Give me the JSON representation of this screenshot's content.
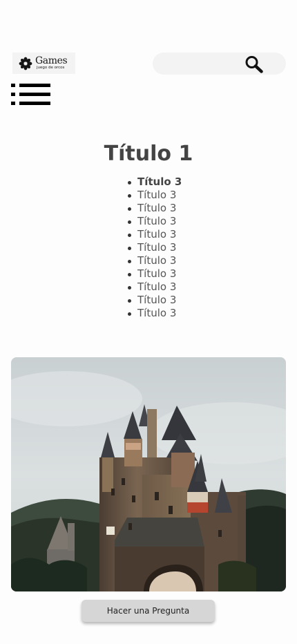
{
  "header": {
    "logo": {
      "brand": "Games",
      "tagline": "juego de orcos"
    },
    "search": {
      "value": "",
      "placeholder": "",
      "icon": "search-icon"
    },
    "menu_icon": "menu-list-icon"
  },
  "main": {
    "title": "Título 1",
    "items": [
      {
        "label": "Título 3",
        "active": true
      },
      {
        "label": "Título 3",
        "active": false
      },
      {
        "label": "Título 3",
        "active": false
      },
      {
        "label": "Título 3",
        "active": false
      },
      {
        "label": "Título 3",
        "active": false
      },
      {
        "label": "Título 3",
        "active": false
      },
      {
        "label": "Título 3",
        "active": false
      },
      {
        "label": "Título 3",
        "active": false
      },
      {
        "label": "Título 3",
        "active": false
      },
      {
        "label": "Título 3",
        "active": false
      },
      {
        "label": "Título 3",
        "active": false
      }
    ],
    "image": {
      "subject": "castle photo"
    }
  },
  "footer": {
    "ask_button_label": "Hacer una Pregunta"
  },
  "colors": {
    "text": "#444444",
    "field_background": "#f3f3f3",
    "button_background": "#d6d6d6"
  }
}
